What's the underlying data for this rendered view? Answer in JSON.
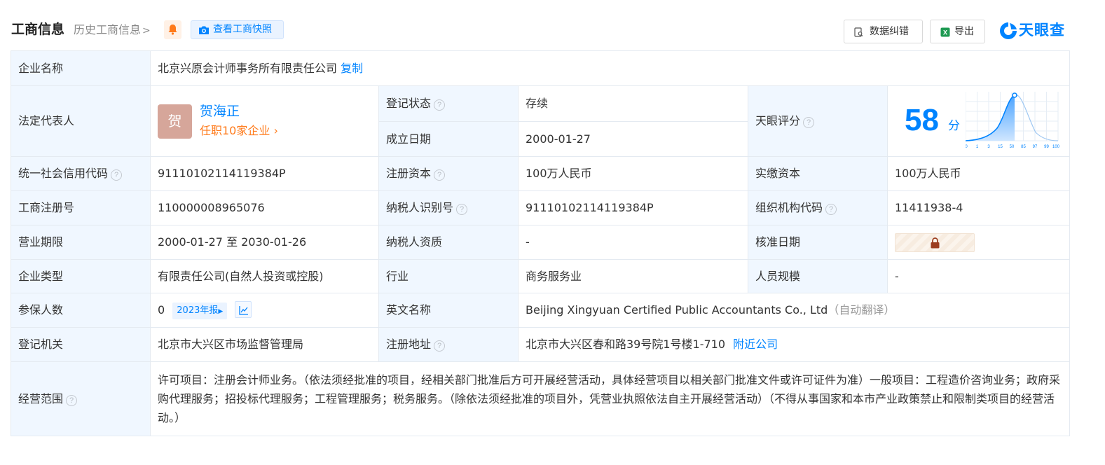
{
  "header": {
    "title": "工商信息",
    "history_link": "历史工商信息",
    "snapshot_button": "查看工商快照",
    "correct_button": "数据纠错",
    "export_button": "导出",
    "logo_text": "天眼查",
    "brand_color": "#0084ff"
  },
  "company_name": {
    "label": "企业名称",
    "value": "北京兴原会计师事务所有限责任公司",
    "copy": "复制"
  },
  "legal_rep": {
    "label": "法定代表人",
    "avatar_char": "贺",
    "name": "贺海正",
    "jobs": "任职10家企业"
  },
  "reg_status": {
    "label": "登记状态",
    "value": "存续"
  },
  "established": {
    "label": "成立日期",
    "value": "2000-01-27"
  },
  "tianyan_score": {
    "label": "天眼评分",
    "score": "58",
    "unit": "分",
    "percentile_ticks": [
      "0",
      "1",
      "3",
      "15",
      "50",
      "85",
      "97",
      "99",
      "100"
    ]
  },
  "credit_code": {
    "label": "统一社会信用代码",
    "value": "91110102114119384P"
  },
  "reg_capital": {
    "label": "注册资本",
    "value": "100万人民币"
  },
  "paid_capital": {
    "label": "实缴资本",
    "value": "100万人民币"
  },
  "reg_number": {
    "label": "工商注册号",
    "value": "110000008965076"
  },
  "taxpayer_id": {
    "label": "纳税人识别号",
    "value": "91110102114119384P"
  },
  "org_code": {
    "label": "组织机构代码",
    "value": "11411938-4"
  },
  "business_term": {
    "label": "营业期限",
    "value": "2000-01-27 至 2030-01-26"
  },
  "taxpayer_qual": {
    "label": "纳税人资质",
    "value": "-"
  },
  "approval_date": {
    "label": "核准日期"
  },
  "company_type": {
    "label": "企业类型",
    "value": "有限责任公司(自然人投资或控股)"
  },
  "industry": {
    "label": "行业",
    "value": "商务服务业"
  },
  "staff_size": {
    "label": "人员规模",
    "value": "-"
  },
  "insured": {
    "label": "参保人数",
    "value": "0",
    "report": "2023年报"
  },
  "english_name": {
    "label": "英文名称",
    "value": "Beijing Xingyuan Certified Public Accountants Co., Ltd",
    "note": "（自动翻译）"
  },
  "reg_authority": {
    "label": "登记机关",
    "value": "北京市大兴区市场监督管理局"
  },
  "reg_address": {
    "label": "注册地址",
    "value": "北京市大兴区春和路39号院1号楼1-710",
    "nearby": "附近公司"
  },
  "business_scope": {
    "label": "经营范围",
    "value": "许可项目：注册会计师业务。（依法须经批准的项目，经相关部门批准后方可开展经营活动，具体经营项目以相关部门批准文件或许可证件为准）一般项目：工程造价咨询业务；政府采购代理服务；招投标代理服务；工程管理服务；税务服务。（除依法须经批准的项目外，凭营业执照依法自主开展经营活动）（不得从事国家和本市产业政策禁止和限制类项目的经营活动。）"
  }
}
